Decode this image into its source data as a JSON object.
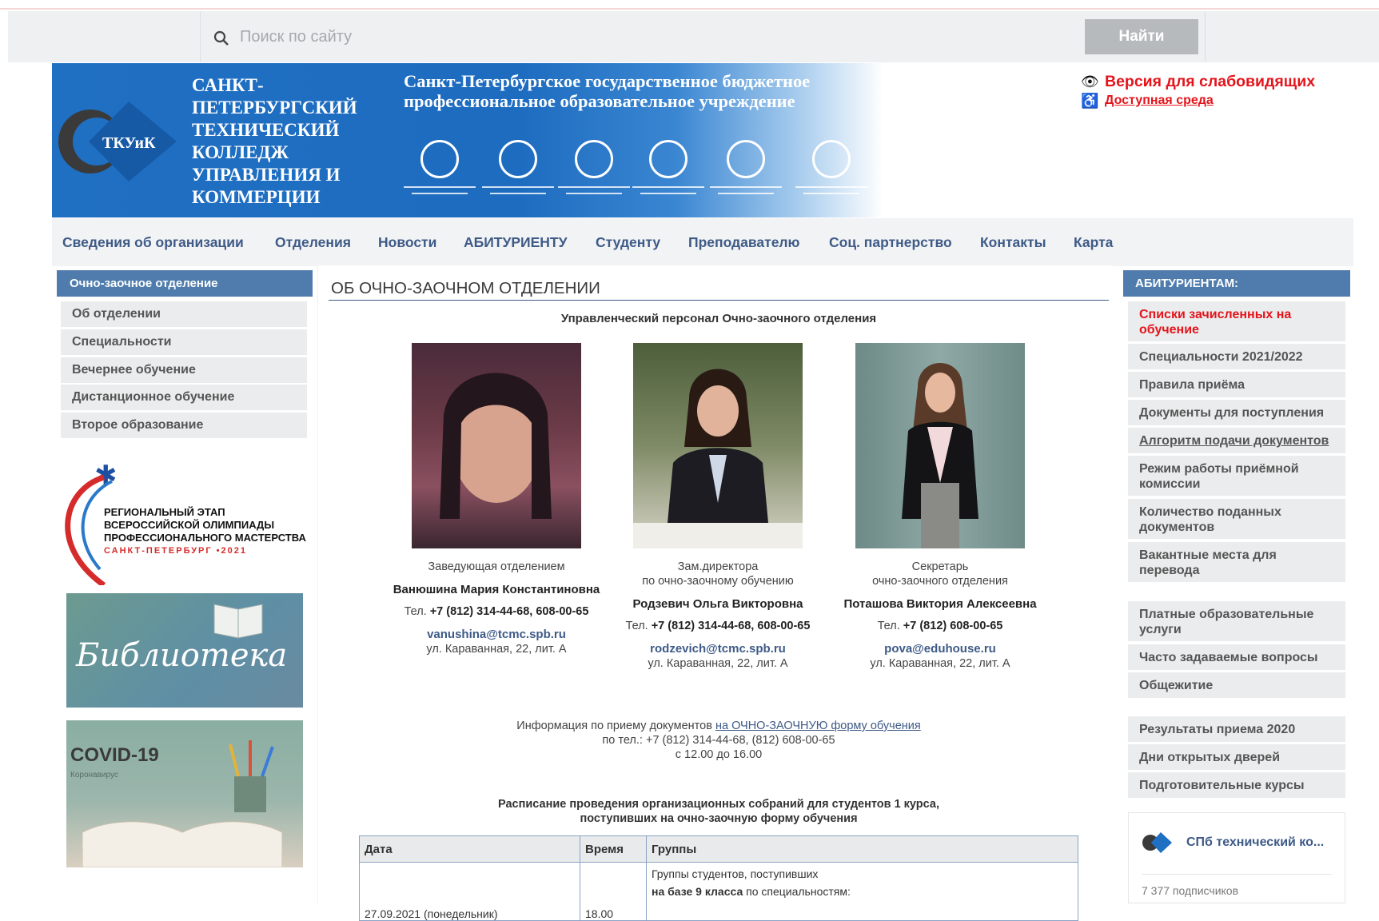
{
  "search": {
    "placeholder": "Поиск по сайту",
    "button": "Найти"
  },
  "header": {
    "logo_text": "ТКУиК",
    "college_name": "САНКТ-ПЕТЕРБУРГСКИЙ ТЕХНИЧЕСКИЙ КОЛЛЕДЖ УПРАВЛЕНИЯ И КОММЕРЦИИ",
    "org_name": "Санкт-Петербургское государственное бюджетное профессиональное образовательное учреждение",
    "accessibility_version": "Версия для слабовидящих",
    "accessible_environment": "Доступная среда"
  },
  "nav": [
    "Сведения об организации",
    "Отделения",
    "Новости",
    "АБИТУРИЕНТУ",
    "Студенту",
    "Преподавателю",
    "Соц. партнерство",
    "Контакты",
    "Карта"
  ],
  "left_sidebar": {
    "title": "Очно-заочное отделение",
    "items": [
      "Об отделении",
      "Специальности",
      "Вечернее обучение",
      "Дистанционное обучение",
      "Второе образование"
    ],
    "olympiad": {
      "line1": "РЕГИОНАЛЬНЫЙ ЭТАП",
      "line2": "ВСЕРОССИЙСКОЙ ОЛИМПИАДЫ",
      "line3": "ПРОФЕССИОНАЛЬНОГО МАСТЕРСТВА",
      "line4": "САНКТ-ПЕТЕРБУРГ •2021"
    },
    "library": "Библиотека",
    "covid_title": "COVID-19",
    "covid_sub": "Коронавирус"
  },
  "main": {
    "title": "ОБ ОЧНО-ЗАОЧНОМ ОТДЕЛЕНИИ",
    "subtitle": "Управленческий персонал Очно-заочного отделения",
    "staff": [
      {
        "role": "Заведующая отделением",
        "name": "Ванюшина Мария Константиновна",
        "tel_label": "Тел.",
        "tel": "+7 (812) 314-44-68, 608-00-65",
        "email": "vanushina@tcmc.spb.ru",
        "address": "ул. Караванная, 22, лит. А"
      },
      {
        "role": "Зам.директора\nпо очно-заочному обучению",
        "name": "Родзевич Ольга Викторовна",
        "tel_label": "Тел.",
        "tel": "+7 (812) 314-44-68, 608-00-65",
        "email": "rodzevich@tcmc.spb.ru",
        "address": "ул. Караванная, 22, лит. А"
      },
      {
        "role": "Секретарь\nочно-заочного отделения",
        "name": "Поташова Виктория Алексеевна",
        "tel_label": "Тел.",
        "tel": "+7 (812) 608-00-65",
        "email": "pova@eduhouse.ru",
        "address": "ул. Караванная, 22, лит. А"
      }
    ],
    "info_prefix": "Информация по приему документов",
    "info_link": "на ОЧНО-ЗАОЧНУЮ форму обучения",
    "info_phone": "по тел.: +7 (812) 314-44-68, (812) 608-00-65",
    "info_hours": "с 12.00 до 16.00",
    "schedule_title_1": "Расписание проведения организационных собраний для студентов 1 курса,",
    "schedule_title_2": "поступивших на очно-заочную форму обучения",
    "table": {
      "headers": [
        "Дата",
        "Время",
        "Группы"
      ],
      "row": {
        "date": "27.09.2021 (понедельник)",
        "time": "18.00",
        "groups_1": "Группы студентов, поступивших",
        "groups_2_bold": "на базе 9 класса",
        "groups_2_rest": " по специальностям:"
      }
    }
  },
  "right_sidebar": {
    "title": "АБИТУРИЕНТАМ:",
    "items": [
      "Списки зачисленных на обучение",
      "Специальности 2021/2022",
      "Правила приёма",
      "Документы для поступления",
      "Алгоритм подачи документов",
      "Режим работы приёмной комиссии",
      "Количество поданных документов",
      "Вакантные места для перевода",
      "Платные образовательные услуги",
      "Часто задаваемые вопросы",
      "Общежитие",
      "Результаты приема 2020",
      "Дни открытых дверей",
      "Подготовительные курсы"
    ],
    "vk_name": "СПб технический ко...",
    "vk_subscribers": "7 377 подписчиков"
  },
  "colors": {
    "accent": "#4f7cac",
    "link": "#3e5a87",
    "alert": "#e4141b",
    "banner": "#1f6fc2"
  }
}
